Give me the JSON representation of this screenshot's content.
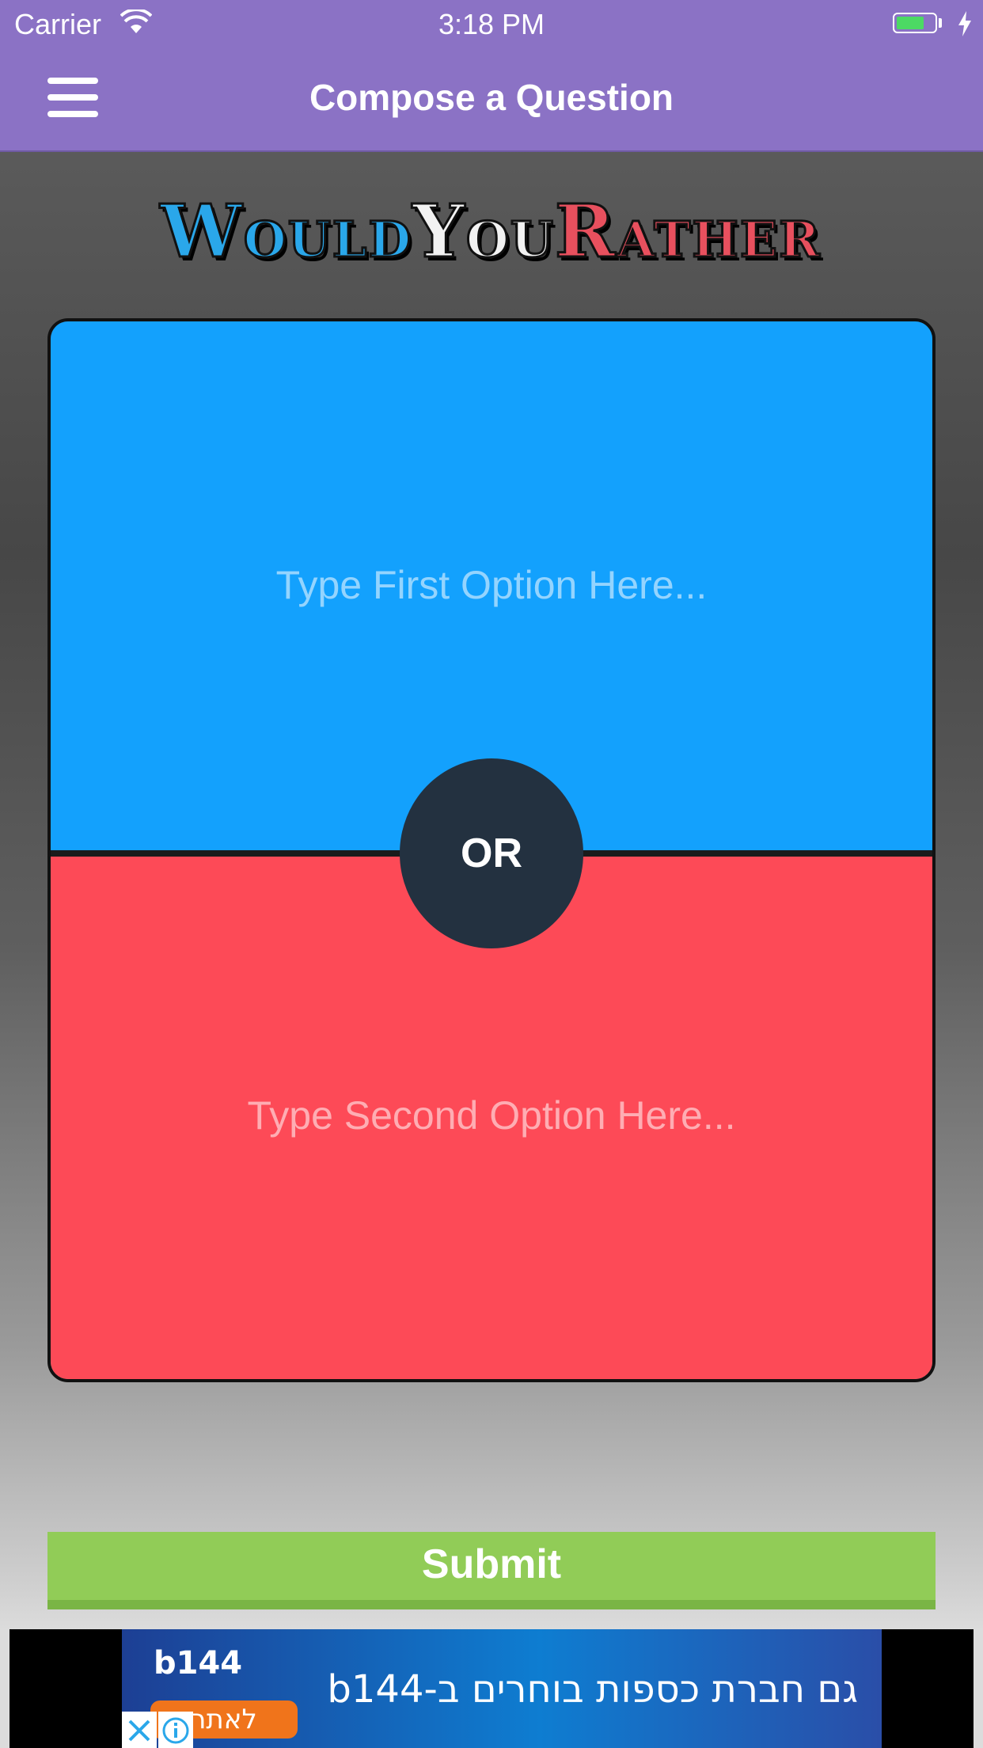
{
  "status_bar": {
    "carrier": "Carrier",
    "time": "3:18 PM",
    "battery_level": 0.65,
    "charging": true
  },
  "nav": {
    "title": "Compose a Question",
    "menu_icon": "hamburger-menu-icon"
  },
  "logo": {
    "part1_cap": "W",
    "part1_rest": "OULD",
    "part2_cap": "Y",
    "part2_rest": "OU",
    "part3_cap": "R",
    "part3_rest": "ATHER"
  },
  "question": {
    "option1_placeholder": "Type First Option Here...",
    "option2_placeholder": "Type Second Option Here...",
    "separator": "OR"
  },
  "submit_label": "Submit",
  "ad": {
    "brand": "b144",
    "headline": "גם חברת כספות בוחרים ב-b144",
    "cta": "לאתר",
    "close_icon": "close-icon",
    "info_icon": "info-icon"
  },
  "colors": {
    "nav_bar": "#8b72c5",
    "option1": "#13a1fd",
    "option2": "#fd4a57",
    "or_circle": "#233140",
    "submit": "#91cc57"
  }
}
